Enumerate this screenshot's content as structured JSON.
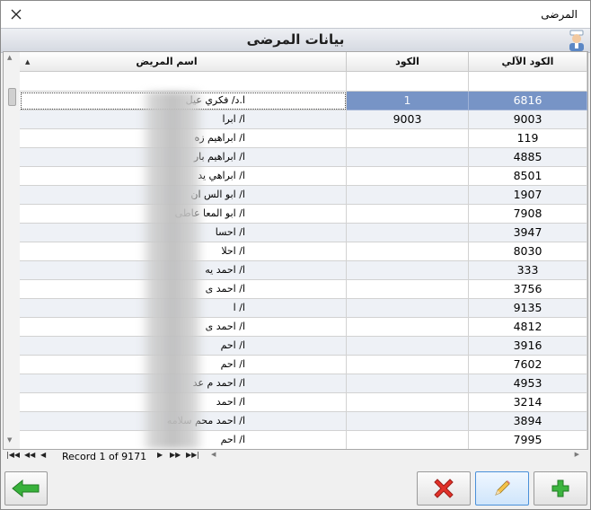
{
  "window": {
    "title": "المرضى"
  },
  "header": {
    "title": "بيانات المرضى"
  },
  "grid": {
    "columns": {
      "name": "اسم المريض",
      "code": "الكود",
      "auto_code": "الكود الآلي"
    },
    "rows": [
      {
        "auto_code": "6816",
        "code": "1",
        "name": "ا.د/ فكري        عيل"
      },
      {
        "auto_code": "9003",
        "code": "9003",
        "name": "ا/ ابرا"
      },
      {
        "auto_code": "119",
        "code": "",
        "name": "ا/ ابراهيم          زه"
      },
      {
        "auto_code": "4885",
        "code": "",
        "name": "ا/ ابراهيم          بار"
      },
      {
        "auto_code": "8501",
        "code": "",
        "name": "ا/ ابراهي          يد"
      },
      {
        "auto_code": "1907",
        "code": "",
        "name": "ا/ ابو الس          ان"
      },
      {
        "auto_code": "7908",
        "code": "",
        "name": "ا/ ابو المعا          عاطى"
      },
      {
        "auto_code": "3947",
        "code": "",
        "name": "ا/ احسا"
      },
      {
        "auto_code": "8030",
        "code": "",
        "name": "ا/ احلا"
      },
      {
        "auto_code": "333",
        "code": "",
        "name": "ا/ احمد          يه"
      },
      {
        "auto_code": "3756",
        "code": "",
        "name": "ا/ احمد          ى"
      },
      {
        "auto_code": "9135",
        "code": "",
        "name": "ا/ ا"
      },
      {
        "auto_code": "4812",
        "code": "",
        "name": "ا/ احمد          ى"
      },
      {
        "auto_code": "3916",
        "code": "",
        "name": "ا/ احم"
      },
      {
        "auto_code": "7602",
        "code": "",
        "name": "ا/ احم"
      },
      {
        "auto_code": "4953",
        "code": "",
        "name": "ا/ احمد م          عد"
      },
      {
        "auto_code": "3214",
        "code": "",
        "name": "ا/ احمد"
      },
      {
        "auto_code": "3894",
        "code": "",
        "name": "ا/ احمد محم          سلامه"
      },
      {
        "auto_code": "7995",
        "code": "",
        "name": "ا/ احم"
      }
    ]
  },
  "navigator": {
    "record_text": "Record 1 of 9171"
  },
  "colors": {
    "selected": "#7794c6",
    "alt_row": "#eef1f6"
  },
  "icons": {
    "back": "green-left-arrow-icon",
    "delete": "red-x-icon",
    "edit": "pencil-icon",
    "add": "green-plus-icon",
    "window": "doctor-icon"
  }
}
